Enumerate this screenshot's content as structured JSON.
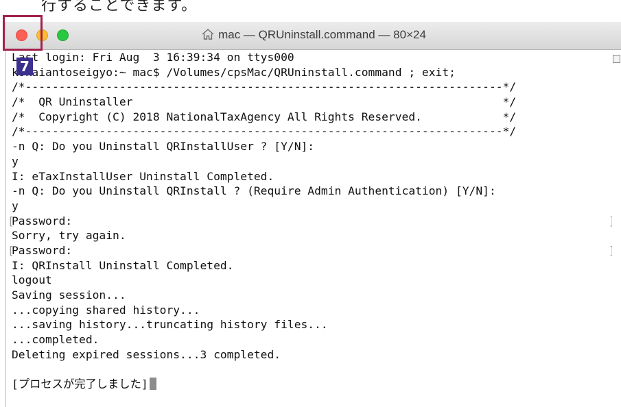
{
  "caption": "行することできます。",
  "window": {
    "title": "mac — QRUninstall.command — 80×24",
    "title_icon": "home-icon"
  },
  "annotation": {
    "step_number": "7",
    "color": "#a0214a",
    "badge_color": "#3b2f8f"
  },
  "terminal": {
    "lines": [
      "Last login: Fri Aug  3 16:39:34 on ttys000",
      "kokaiantoseigyo:~ mac$ /Volumes/cpsMac/QRUninstall.command ; exit;",
      "/*-----------------------------------------------------------------------*/",
      "/*  QR Uninstaller                                                       */",
      "/*  Copyright (C) 2018 NationalTaxAgency All Rights Reserved.            */",
      "/*-----------------------------------------------------------------------*/",
      "-n Q: Do you Uninstall QRInstallUser ? [Y/N]:",
      "y",
      "I: eTaxInstallUser Uninstall Completed.",
      "-n Q: Do you Uninstall QRInstall ? (Require Admin Authentication) [Y/N]:",
      "y",
      "Password:",
      "Sorry, try again.",
      "Password:",
      "I: QRInstall Uninstall Completed.",
      "logout",
      "Saving session...",
      "...copying shared history...",
      "...saving history...truncating history files...",
      "...completed.",
      "Deleting expired sessions...3 completed.",
      "",
      "[プロセスが完了しました]"
    ]
  }
}
